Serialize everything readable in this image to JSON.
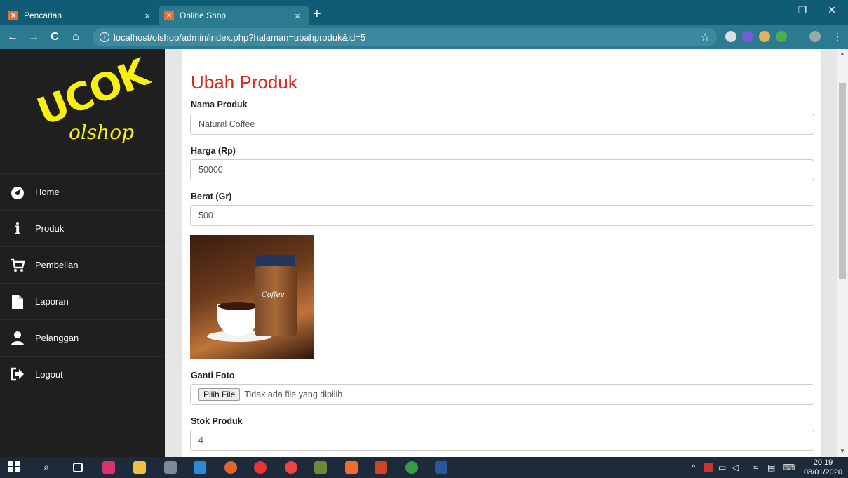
{
  "browser": {
    "tabs": [
      {
        "title": "Pencarian",
        "close": "×"
      },
      {
        "title": "Online Shop",
        "close": "×"
      }
    ],
    "new_tab": "+",
    "url": "localhost/olshop/admin/index.php?halaman=ubahproduk&id=5",
    "window_controls": [
      "–",
      "❐",
      "✕"
    ],
    "nav": [
      "←",
      "→",
      "C",
      "⌂"
    ]
  },
  "sidebar": {
    "logo": {
      "main": "UCOK",
      "sub": "olshop"
    },
    "items": [
      {
        "label": "Home",
        "icon": "dashboard-icon"
      },
      {
        "label": "Produk",
        "icon": "info-icon"
      },
      {
        "label": "Pembelian",
        "icon": "shopping-cart-icon"
      },
      {
        "label": "Laporan",
        "icon": "file-icon"
      },
      {
        "label": "Pelanggan",
        "icon": "user-icon"
      },
      {
        "label": "Logout",
        "icon": "logout-icon"
      }
    ]
  },
  "form": {
    "title": "Ubah Produk",
    "nama_label": "Nama Produk",
    "nama_value": "Natural Coffee",
    "harga_label": "Harga (Rp)",
    "harga_value": "50000",
    "berat_label": "Berat (Gr)",
    "berat_value": "500",
    "image_text": "Coffee",
    "foto_label": "Ganti Foto",
    "file_button": "Pilih File",
    "file_status": "Tidak ada file yang dipilih",
    "stok_label": "Stok Produk",
    "stok_value": "4"
  },
  "taskbar": {
    "time": "20.19",
    "date": "08/01/2020"
  },
  "colors": {
    "accent": "#d9271a",
    "sidebar": "#1f1f1f",
    "browser_frame": "#0f5c74",
    "logo": "#f7ef12"
  }
}
